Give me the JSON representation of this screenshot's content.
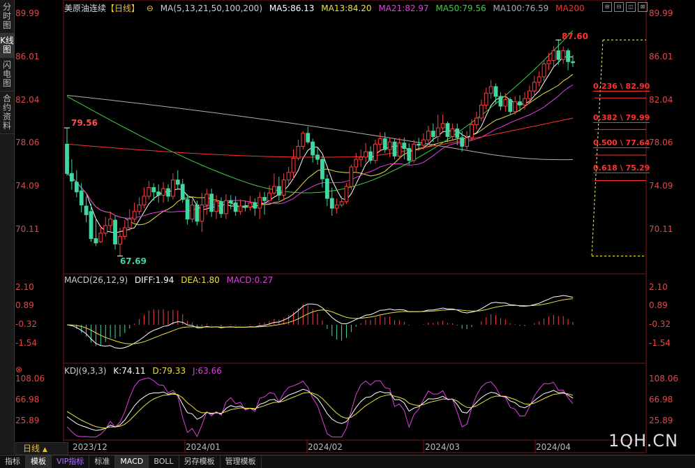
{
  "sidebar": {
    "tabs": [
      {
        "label": "分时图",
        "active": false
      },
      {
        "label": "K线图",
        "active": true
      },
      {
        "label": "闪电图",
        "active": false
      },
      {
        "label": "合约资料",
        "active": false
      }
    ]
  },
  "chart_header": {
    "title": "美原油连续",
    "period_tag": "【日线】",
    "ma_params": "MA(5,13,21,50,100,200)",
    "ma5": "MA5:86.13",
    "ma13": "MA13:84.20",
    "ma21": "MA21:82.97",
    "ma50": "MA50:79.56",
    "ma100": "MA100:76.59",
    "ma200": "MA200"
  },
  "macd_header": {
    "params": "MACD(26,12,9)",
    "diff": "DIFF:1.94",
    "dea": "DEA:1.80",
    "macd": "MACD:0.27"
  },
  "kdj_header": {
    "params": "KDJ(9,3,3)",
    "k": "K:74.11",
    "d": "D:79.33",
    "j": "J:63.66"
  },
  "price_axis": [
    "89.99",
    "86.01",
    "82.04",
    "78.06",
    "74.09",
    "70.11"
  ],
  "macd_axis": [
    "2.10",
    "0.89",
    "-0.32",
    "-1.54"
  ],
  "kdj_axis": [
    "108.06",
    "66.98",
    "25.89"
  ],
  "annotations": {
    "high": "87.60",
    "low": "67.69",
    "swing": "79.56"
  },
  "fibonacci": [
    {
      "label": "0.236 \\ 82.90",
      "price": 82.9
    },
    {
      "label": "0.382 \\ 79.99",
      "price": 79.99
    },
    {
      "label": "0.500 \\ 77.64",
      "price": 77.64
    },
    {
      "label": "0.618 \\ 75.29",
      "price": 75.29
    }
  ],
  "x_axis": [
    "2023/12",
    "2024/01",
    "2024/02",
    "2024/03",
    "2024/04"
  ],
  "period_button": "日线",
  "bottom_tabs": [
    "指标",
    "模板",
    "VIP指标",
    "标准",
    "MACD",
    "BOLL",
    "另存模板",
    "管理模板"
  ],
  "watermark": "1QH.CN",
  "colors": {
    "up": "#ff4040",
    "down": "#40d8a0",
    "ma5": "#ffffff",
    "ma13": "#e8e040",
    "ma21": "#e040e0",
    "ma50": "#40d040",
    "ma100": "#b0b0b0",
    "ma200": "#ff3030"
  },
  "chart_data": {
    "type": "candlestick",
    "ylim": [
      66.5,
      90.5
    ],
    "price_ticks": [
      89.99,
      86.01,
      82.04,
      78.06,
      74.09,
      70.11
    ],
    "candles": [
      [
        78.0,
        75.3,
        79.5,
        75.1
      ],
      [
        75.3,
        74.6,
        76.6,
        73.8
      ],
      [
        74.5,
        73.6,
        75.6,
        73.1
      ],
      [
        73.7,
        72.4,
        74.4,
        71.7
      ],
      [
        72.3,
        71.5,
        73.2,
        70.8
      ],
      [
        71.8,
        69.3,
        72.5,
        69.0
      ],
      [
        69.3,
        68.9,
        71.2,
        68.6
      ],
      [
        69.0,
        69.8,
        70.5,
        68.9
      ],
      [
        69.8,
        70.5,
        71.3,
        69.5
      ],
      [
        70.5,
        71.1,
        71.8,
        70.0
      ],
      [
        71.0,
        68.8,
        71.4,
        68.3
      ],
      [
        68.8,
        69.5,
        70.3,
        67.7
      ],
      [
        69.5,
        70.3,
        71.0,
        69.2
      ],
      [
        70.3,
        71.1,
        72.0,
        70.0
      ],
      [
        71.1,
        71.8,
        72.6,
        70.8
      ],
      [
        71.8,
        72.4,
        73.1,
        71.5
      ],
      [
        72.4,
        73.2,
        74.0,
        72.1
      ],
      [
        73.2,
        74.0,
        74.6,
        72.9
      ],
      [
        74.0,
        73.6,
        74.4,
        72.8
      ],
      [
        73.6,
        73.3,
        74.3,
        72.6
      ],
      [
        73.3,
        73.9,
        74.5,
        72.6
      ],
      [
        73.9,
        73.2,
        74.3,
        72.7
      ],
      [
        73.2,
        74.7,
        75.3,
        72.9
      ],
      [
        74.7,
        74.3,
        75.6,
        73.8
      ],
      [
        74.3,
        72.9,
        74.8,
        72.6
      ],
      [
        72.9,
        71.1,
        73.4,
        70.6
      ],
      [
        71.1,
        72.4,
        72.9,
        70.8
      ],
      [
        72.4,
        70.9,
        72.8,
        70.5
      ],
      [
        70.9,
        72.4,
        73.5,
        69.9
      ],
      [
        72.4,
        73.4,
        73.9,
        71.5
      ],
      [
        73.4,
        71.8,
        73.9,
        71.3
      ],
      [
        71.8,
        72.7,
        73.3,
        71.1
      ],
      [
        72.7,
        71.6,
        73.1,
        71.2
      ],
      [
        71.6,
        72.8,
        73.4,
        71.1
      ],
      [
        72.8,
        72.6,
        73.3,
        72.0
      ],
      [
        72.6,
        71.8,
        73.2,
        71.4
      ],
      [
        71.8,
        72.3,
        72.9,
        71.5
      ],
      [
        72.3,
        72.2,
        72.8,
        71.8
      ],
      [
        72.2,
        72.6,
        73.2,
        71.9
      ],
      [
        72.6,
        72.1,
        73.0,
        71.4
      ],
      [
        72.1,
        73.1,
        73.6,
        71.1
      ],
      [
        73.1,
        72.8,
        73.6,
        71.5
      ],
      [
        72.8,
        73.5,
        74.2,
        72.7
      ],
      [
        73.5,
        74.1,
        75.3,
        73.3
      ],
      [
        74.1,
        73.3,
        75.0,
        72.8
      ],
      [
        73.3,
        74.7,
        75.3,
        72.9
      ],
      [
        74.7,
        75.4,
        75.9,
        74.3
      ],
      [
        75.4,
        76.7,
        77.5,
        74.8
      ],
      [
        76.7,
        77.8,
        78.4,
        76.5
      ],
      [
        77.8,
        79.0,
        79.2,
        77.5
      ],
      [
        79.0,
        78.2,
        79.6,
        78.0
      ],
      [
        78.2,
        77.0,
        78.5,
        76.3
      ],
      [
        77.0,
        76.6,
        77.7,
        76.1
      ],
      [
        76.6,
        74.8,
        76.9,
        74.0
      ],
      [
        74.8,
        73.0,
        75.2,
        72.3
      ],
      [
        73.0,
        72.1,
        74.0,
        71.4
      ],
      [
        72.1,
        72.4,
        73.0,
        71.6
      ],
      [
        72.4,
        72.7,
        73.2,
        72.2
      ],
      [
        72.7,
        74.1,
        74.4,
        72.5
      ],
      [
        74.1,
        75.9,
        76.1,
        73.8
      ],
      [
        75.9,
        76.6,
        77.2,
        75.4
      ],
      [
        76.6,
        76.8,
        77.5,
        75.9
      ],
      [
        76.8,
        77.3,
        78.1,
        76.3
      ],
      [
        77.3,
        76.5,
        77.8,
        76.2
      ],
      [
        76.5,
        78.0,
        78.4,
        76.2
      ],
      [
        78.0,
        78.5,
        79.1,
        77.3
      ],
      [
        78.5,
        77.5,
        79.1,
        77.2
      ],
      [
        77.5,
        78.2,
        78.6,
        76.8
      ],
      [
        78.2,
        76.9,
        78.5,
        76.6
      ],
      [
        76.9,
        78.1,
        78.6,
        76.6
      ],
      [
        78.1,
        77.6,
        78.6,
        76.6
      ],
      [
        77.6,
        76.5,
        78.1,
        76.1
      ],
      [
        76.5,
        78.0,
        78.4,
        76.3
      ],
      [
        78.0,
        77.9,
        78.6,
        77.4
      ],
      [
        77.9,
        78.4,
        79.0,
        77.5
      ],
      [
        78.4,
        79.2,
        79.7,
        78.0
      ],
      [
        79.2,
        78.7,
        79.9,
        78.2
      ],
      [
        78.7,
        79.5,
        80.7,
        78.2
      ],
      [
        79.5,
        79.9,
        80.7,
        79.2
      ],
      [
        79.9,
        78.7,
        80.1,
        78.2
      ],
      [
        78.7,
        79.4,
        79.9,
        78.4
      ],
      [
        79.4,
        78.6,
        79.9,
        77.9
      ],
      [
        78.6,
        77.8,
        79.2,
        77.3
      ],
      [
        77.8,
        78.6,
        79.2,
        77.5
      ],
      [
        78.6,
        79.8,
        80.3,
        78.3
      ],
      [
        79.8,
        80.4,
        81.0,
        79.4
      ],
      [
        80.4,
        81.6,
        82.1,
        80.1
      ],
      [
        81.6,
        82.7,
        83.2,
        81.2
      ],
      [
        82.7,
        83.3,
        83.9,
        82.2
      ],
      [
        83.3,
        82.4,
        83.6,
        81.7
      ],
      [
        82.4,
        81.5,
        82.8,
        81.1
      ],
      [
        81.5,
        82.1,
        82.7,
        81.0
      ],
      [
        82.1,
        81.0,
        82.3,
        80.7
      ],
      [
        81.0,
        81.9,
        82.4,
        80.7
      ],
      [
        81.9,
        81.6,
        82.5,
        81.0
      ],
      [
        81.6,
        82.2,
        82.8,
        81.2
      ],
      [
        82.2,
        82.9,
        83.4,
        81.8
      ],
      [
        82.9,
        83.7,
        84.3,
        82.4
      ],
      [
        83.7,
        84.2,
        84.7,
        83.3
      ],
      [
        84.2,
        85.4,
        85.7,
        83.8
      ],
      [
        85.4,
        85.7,
        86.4,
        84.8
      ],
      [
        85.7,
        86.6,
        87.0,
        85.2
      ],
      [
        86.6,
        85.8,
        87.6,
        85.3
      ],
      [
        85.8,
        86.6,
        87.0,
        85.4
      ],
      [
        86.6,
        85.6,
        86.8,
        84.8
      ],
      [
        85.6,
        85.5,
        86.2,
        85.1
      ]
    ],
    "fib_top": 87.6,
    "fib_bottom": 67.69
  }
}
